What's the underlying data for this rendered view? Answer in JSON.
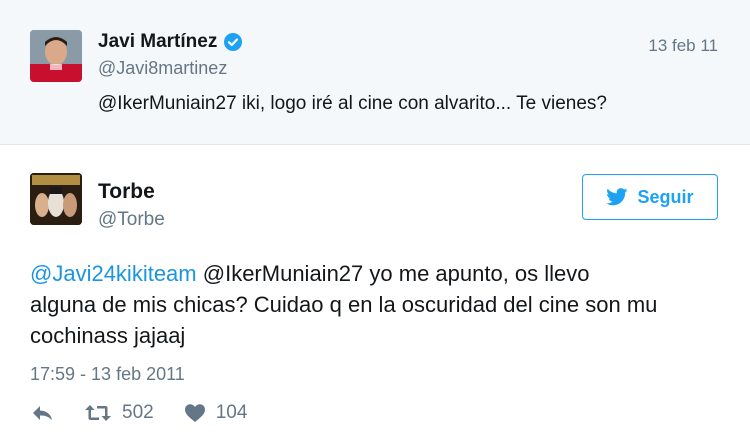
{
  "quoted_tweet": {
    "name": "Javi Martínez",
    "handle": "@Javi8martinez",
    "date": "13 feb 11",
    "text": "@IkerMuniain27 iki, logo iré al cine con alvarito... Te vienes?",
    "verified_icon": "verified-badge-icon"
  },
  "tweet": {
    "name": "Torbe",
    "handle": "@Torbe",
    "follow_label": "Seguir",
    "text_mention_1": "@Javi24kikiteam",
    "text_mention_2": "@IkerMuniain27",
    "text_line_1_rest": " yo me apunto, os llevo",
    "text_line_2": "alguna de mis chicas? Cuidao q en la oscuridad del cine son mu",
    "text_line_3": "cochinass jajaaj",
    "timestamp": "17:59 - 13 feb 2011",
    "retweets": "502",
    "likes": "104"
  },
  "colors": {
    "accent": "#1da1f2",
    "mention": "#1b95e0",
    "muted": "#657786",
    "quoted_bg": "#f5f8fa"
  }
}
